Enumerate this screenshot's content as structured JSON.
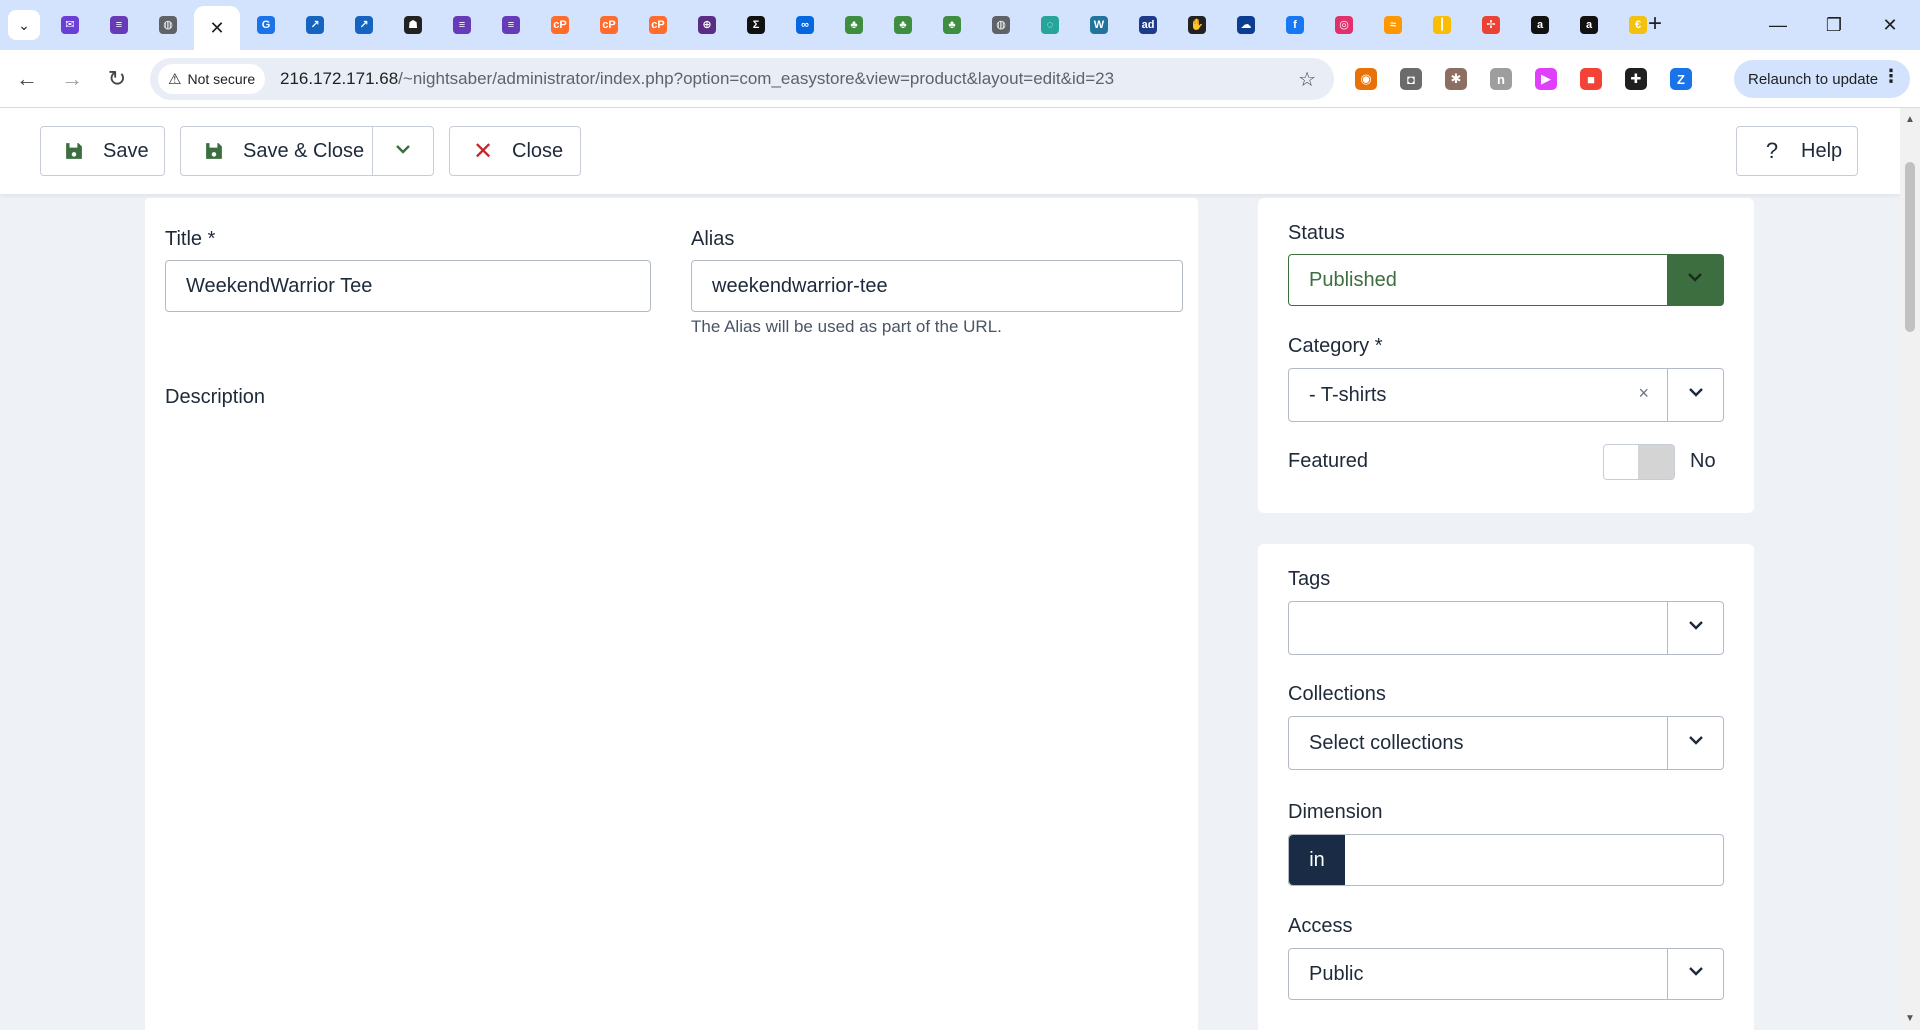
{
  "browser": {
    "tabs": [
      {
        "icon": "gmail-icon",
        "color": "#6a3fd8",
        "glyph": "✉"
      },
      {
        "icon": "forms-icon",
        "color": "#673ab7",
        "glyph": "≡"
      },
      {
        "icon": "globe-icon",
        "color": "#5f6368",
        "glyph": "◍"
      },
      {
        "icon": "close-icon",
        "active": true
      },
      {
        "icon": "translate-icon",
        "color": "#1a73e8",
        "glyph": "G"
      },
      {
        "icon": "hyperlink-icon",
        "color": "#1565c0",
        "glyph": "↗"
      },
      {
        "icon": "hyperlink-icon",
        "color": "#1565c0",
        "glyph": "↗"
      },
      {
        "icon": "person-icon",
        "color": "#222222",
        "glyph": "☗"
      },
      {
        "icon": "forms-icon",
        "color": "#673ab7",
        "glyph": "≡"
      },
      {
        "icon": "forms-icon",
        "color": "#673ab7",
        "glyph": "≡"
      },
      {
        "icon": "cpanel-icon",
        "color": "#ff6c2c",
        "glyph": "cP"
      },
      {
        "icon": "cpanel-icon",
        "color": "#ff6c2c",
        "glyph": "cP"
      },
      {
        "icon": "cpanel-icon",
        "color": "#ff6c2c",
        "glyph": "cP"
      },
      {
        "icon": "target-icon",
        "color": "#5b2c83",
        "glyph": "⊕"
      },
      {
        "icon": "sigma-icon",
        "color": "#111111",
        "glyph": "Σ"
      },
      {
        "icon": "meta-icon",
        "color": "#0668e1",
        "glyph": "∞"
      },
      {
        "icon": "clover-icon",
        "color": "#3e8e41",
        "glyph": "♣"
      },
      {
        "icon": "clover-icon",
        "color": "#3e8e41",
        "glyph": "♣"
      },
      {
        "icon": "clover-icon",
        "color": "#3e8e41",
        "glyph": "♣"
      },
      {
        "icon": "globe-icon",
        "color": "#5f6368",
        "glyph": "◍"
      },
      {
        "icon": "swirl-icon",
        "color": "#26a69a",
        "glyph": "◌"
      },
      {
        "icon": "wordpress-icon",
        "color": "#21759b",
        "glyph": "W"
      },
      {
        "icon": "ad-icon",
        "color": "#1e3a8a",
        "glyph": "ad"
      },
      {
        "icon": "hand-icon",
        "color": "#222222",
        "glyph": "✋"
      },
      {
        "icon": "cloud-icon",
        "color": "#0b3d91",
        "glyph": "☁"
      },
      {
        "icon": "facebook-icon",
        "color": "#1877f2",
        "glyph": "f"
      },
      {
        "icon": "instagram-icon",
        "color": "#e1306c",
        "glyph": "◎"
      },
      {
        "icon": "rss-icon",
        "color": "#ff9800",
        "glyph": "≈"
      },
      {
        "icon": "pin-icon",
        "color": "#fbbc04",
        "glyph": "┃"
      },
      {
        "icon": "pinwheel-icon",
        "color": "#ea4335",
        "glyph": "✢"
      },
      {
        "icon": "amazon-icon",
        "color": "#111111",
        "glyph": "a"
      },
      {
        "icon": "amazon-icon",
        "color": "#111111",
        "glyph": "a"
      },
      {
        "icon": "coin-icon",
        "color": "#f4c20d",
        "glyph": "€"
      }
    ],
    "address": {
      "security_label": "Not secure",
      "host": "216.172.171.68",
      "path": "/~nightsaber/administrator/index.php?option=com_easystore&view=product&layout=edit&id=23"
    },
    "extensions": [
      {
        "icon": "extension-orange-icon",
        "color": "#e8710a",
        "glyph": "◉"
      },
      {
        "icon": "camera-icon",
        "color": "#6b6b6b",
        "glyph": "◘"
      },
      {
        "icon": "bug-icon",
        "color": "#8d6e63",
        "glyph": "✱"
      },
      {
        "icon": "extension-grey-icon",
        "color": "#9e9e9e",
        "glyph": "n"
      },
      {
        "icon": "play-icon",
        "color": "#e040fb",
        "glyph": "▶"
      },
      {
        "icon": "palette-icon",
        "color": "#f44336",
        "glyph": "■"
      },
      {
        "icon": "puzzle-icon",
        "color": "#1f1f1f",
        "glyph": "✚"
      },
      {
        "icon": "z-icon",
        "color": "#1a73e8",
        "glyph": "Z"
      }
    ],
    "relaunch_label": "Relaunch to update"
  },
  "toolbar": {
    "save_label": "Save",
    "save_close_label": "Save & Close",
    "close_label": "Close",
    "help_label": "Help"
  },
  "form": {
    "title_label": "Title *",
    "title_value": "WeekendWarrior Tee",
    "alias_label": "Alias",
    "alias_value": "weekendwarrior-tee",
    "alias_help": "The Alias will be used as part of the URL.",
    "description_label": "Description"
  },
  "sidebar": {
    "status_label": "Status",
    "status_value": "Published",
    "category_label": "Category *",
    "category_value": "- T-shirts",
    "featured_label": "Featured",
    "featured_value": "No",
    "tags_label": "Tags",
    "tags_value": "",
    "collections_label": "Collections",
    "collections_placeholder": "Select collections",
    "dimension_label": "Dimension",
    "dimension_unit": "in",
    "dimension_value": "",
    "access_label": "Access",
    "access_value": "Public"
  },
  "colors": {
    "published_green": "#3d6e3f",
    "dimension_navy": "#1a2b45",
    "close_red": "#c52827"
  }
}
